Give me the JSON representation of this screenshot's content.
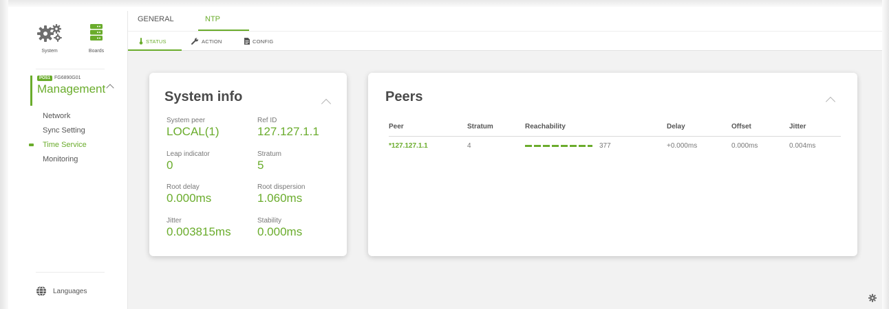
{
  "sidebar": {
    "tiles": [
      {
        "label": "System",
        "icon": "gears-icon"
      },
      {
        "label": "Boards",
        "icon": "boards-icon"
      }
    ],
    "management": {
      "badge": "POS1",
      "device": "FG6890G01",
      "title": "Management"
    },
    "nav": [
      "Network",
      "Sync Setting",
      "Time Service",
      "Monitoring"
    ],
    "active_nav": "Time Service",
    "languages_label": "Languages"
  },
  "tabs": [
    "GENERAL",
    "NTP"
  ],
  "active_tab": "NTP",
  "subtabs": [
    "STATUS",
    "ACTION",
    "CONFIG"
  ],
  "active_subtab": "STATUS",
  "system_info": {
    "title": "System info",
    "fields": [
      {
        "key": "System peer",
        "value": "LOCAL(1)"
      },
      {
        "key": "Ref ID",
        "value": "127.127.1.1"
      },
      {
        "key": "Leap indicator",
        "value": "0"
      },
      {
        "key": "Stratum",
        "value": "5"
      },
      {
        "key": "Root delay",
        "value": "0.000ms"
      },
      {
        "key": "Root dispersion",
        "value": "1.060ms"
      },
      {
        "key": "Jitter",
        "value": "0.003815ms"
      },
      {
        "key": "Stability",
        "value": "0.000ms"
      }
    ]
  },
  "peers": {
    "title": "Peers",
    "columns": [
      "Peer",
      "Stratum",
      "Reachability",
      "Delay",
      "Offset",
      "Jitter"
    ],
    "rows": [
      {
        "peer": "*127.127.1.1",
        "stratum": "4",
        "reachability": "377",
        "delay": "+0.000ms",
        "offset": "0.000ms",
        "jitter": "0.004ms"
      }
    ]
  },
  "colors": {
    "accent": "#6aac2c",
    "text": "#555555",
    "content_bg": "#f2f2f2"
  }
}
